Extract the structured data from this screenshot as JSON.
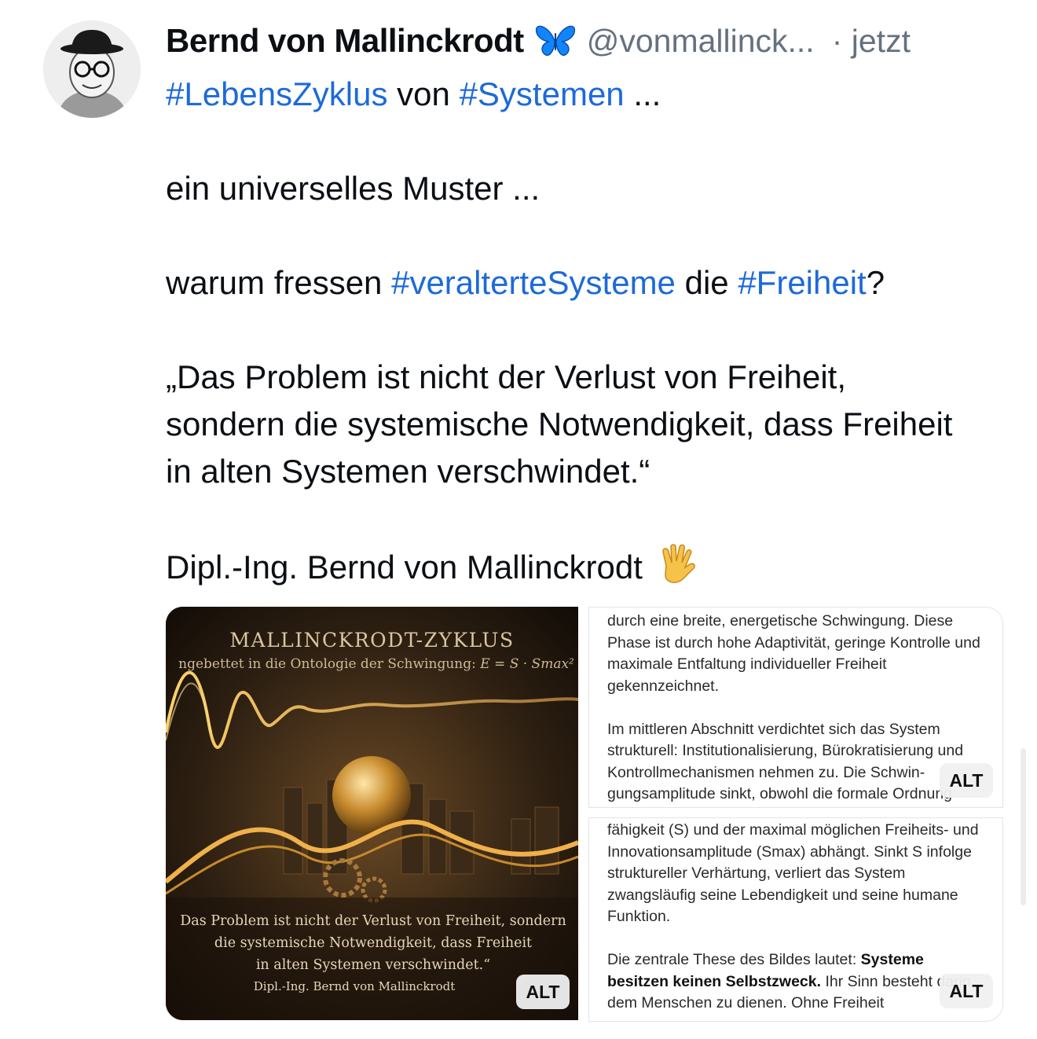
{
  "post": {
    "author_name": "Bernd von Mallinckrodt",
    "verified_icon": "butterfly-icon",
    "handle": "@vonmallinck...",
    "separator": "·",
    "time": "jetzt",
    "line1": {
      "tag1": "#LebensZyklus",
      "mid": " von ",
      "tag2": "#Systemen",
      "end": " ..."
    },
    "line2": "ein universelles Muster ...",
    "line3": {
      "start": "warum fressen ",
      "tag1": "#veralterteSysteme",
      "mid": " die ",
      "tag2": "#Freiheit",
      "end": "?"
    },
    "quote": "„Das Problem ist nicht der Verlust von Freiheit, sondern die systemische Notwendigkeit, dass Freiheit in alten Systemen verschwindet.“",
    "signature": "Dipl.-Ing. Bernd von Mallinckrodt",
    "signature_emoji_icon": "vulcan-salute-hand-icon"
  },
  "media": {
    "main_image": {
      "title": "MALLINCKRODT-ZYKLUS",
      "subtitle": "ngebettet in die Ontologie der Schwingung: ",
      "formula": "E = S · Smax²",
      "quote_line1": "Das Problem ist nicht der Verlust von Freiheit, sondern",
      "quote_line2": "die systemische Notwendigkeit, dass Freiheit",
      "quote_line3": "in alten Systemen verschwindet.“",
      "signature": "Dipl.-Ing. Bernd von Mallinckrodt",
      "alt_label": "ALT"
    },
    "doc_top": {
      "p1": "durch eine breite, energetische Schwingung. Diese Phase ist durch hohe Adaptivität, geringe Kontrolle und maximale Entfaltung individueller Freiheit gekennzeichnet.",
      "p2": "Im mittleren Abschnitt verdichtet sich das System strukturell: Institutionalisierung, Bürokratisierung und Kontrollmechanismen nehmen zu. Die Schwin­gungsamplitude sinkt, obwohl die formale Ordnung",
      "alt_label": "ALT"
    },
    "doc_bottom": {
      "p1": "fähigkeit (S) und der maximal möglichen Freiheits- und Innovationsamplitude (Smax) abhängt. Sinkt S infolge struktureller Verhärtung, verliert das System zwangsläufig seine Lebendigkeit und seine humane Funktion.",
      "p2_start": "Die zentrale These des Bildes lautet: ",
      "p2_bold": "Systeme besitzen keinen Selbstzweck.",
      "p2_end": " Ihr Sinn besteht darin, dem Menschen zu dienen. Ohne Freiheit",
      "alt_label": "ALT"
    }
  },
  "colors": {
    "hashtag": "#1d6ad9",
    "muted": "#66717f",
    "text": "#0b0f14"
  }
}
